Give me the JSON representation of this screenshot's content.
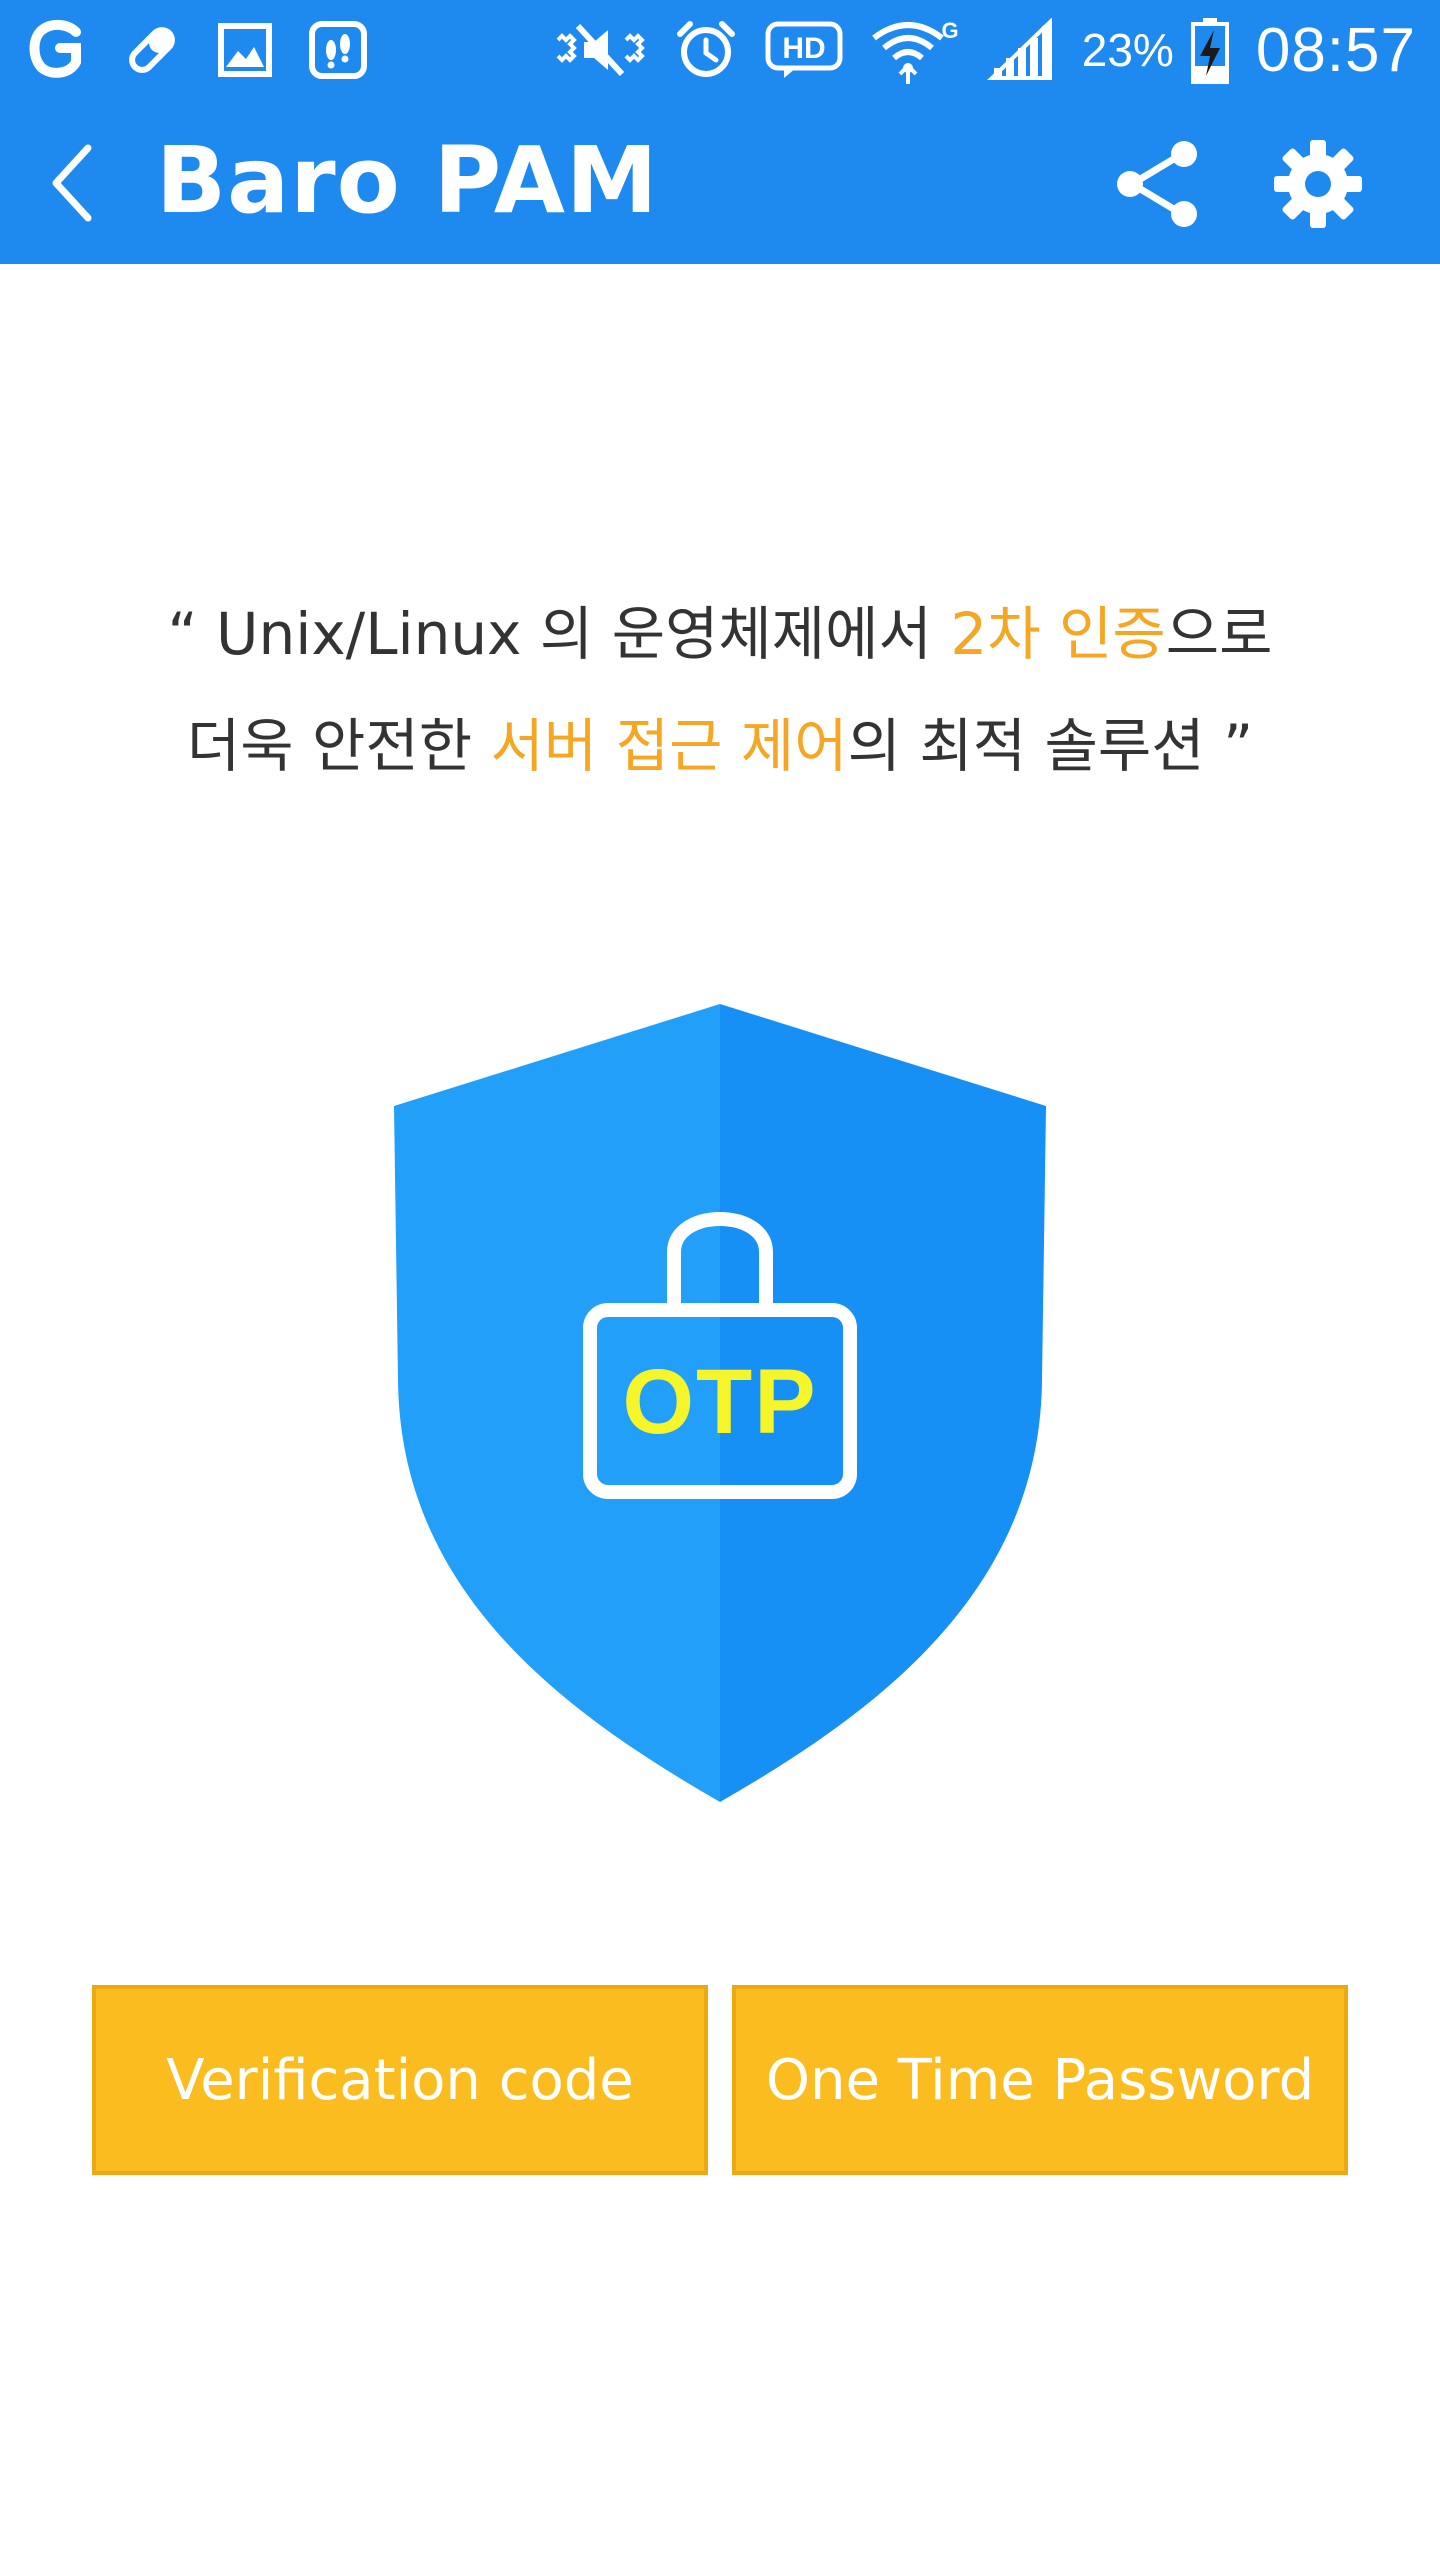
{
  "status_bar": {
    "battery_percent": "23%",
    "time": "08:57",
    "hd_label": "HD",
    "network_type": "G"
  },
  "app_bar": {
    "title": "Baro PAM"
  },
  "tagline": {
    "line1": [
      {
        "text": "“ Unix/Linux 의 운영체제에서 ",
        "highlight": false
      },
      {
        "text": "2차 인증",
        "highlight": true
      },
      {
        "text": "으로",
        "highlight": false
      }
    ],
    "line2": [
      {
        "text": "더욱 안전한 ",
        "highlight": false
      },
      {
        "text": "서버 접근 제어",
        "highlight": true
      },
      {
        "text": "의 최적 솔루션 ”",
        "highlight": false
      }
    ]
  },
  "shield": {
    "lock_label": "OTP"
  },
  "buttons": {
    "verification_code": "Verification code",
    "one_time_password": "One Time Password"
  },
  "colors": {
    "primary_blue": "#1e8af0",
    "shield_light": "#229ff9",
    "shield_dark": "#1690f5",
    "highlight_orange": "#f5a623",
    "button_yellow": "#fbbc20",
    "otp_text": "#f5f52a"
  }
}
